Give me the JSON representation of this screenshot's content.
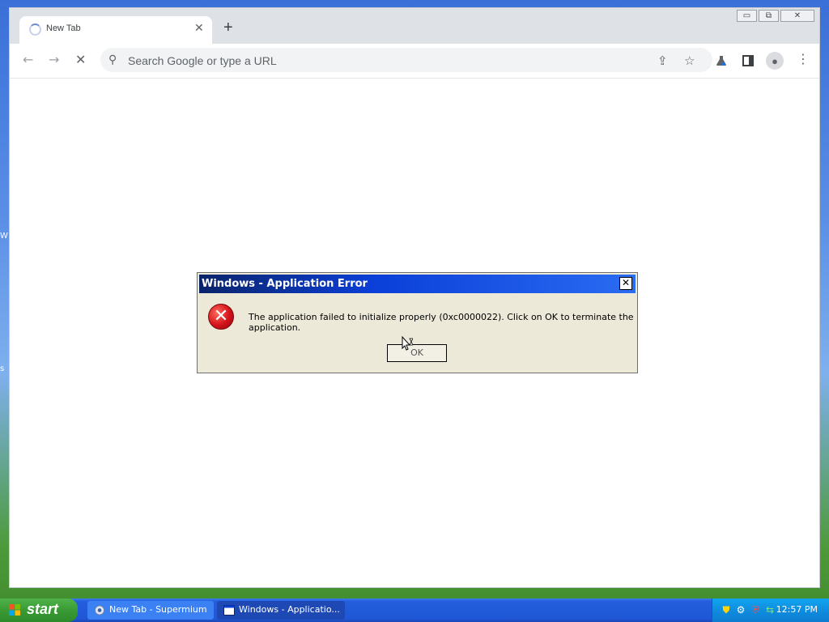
{
  "desktop": {
    "edge_letters": [
      "W",
      "s"
    ]
  },
  "browser": {
    "tab": {
      "title": "New Tab",
      "close_glyph": "✕"
    },
    "new_tab_glyph": "+",
    "window_controls": {
      "minimize": "▭",
      "restore": "⧉",
      "close": "✕"
    },
    "nav": {
      "back_glyph": "←",
      "forward_glyph": "→",
      "stop_glyph": "✕"
    },
    "omnibox": {
      "placeholder": "Search Google or type a URL",
      "value": ""
    },
    "icons": [
      "share-icon",
      "star-icon",
      "labs-icon",
      "side-panel-icon",
      "profile-icon",
      "menu-icon"
    ]
  },
  "dialog": {
    "title": "Windows - Application Error",
    "close_glyph": "✕",
    "message": "The application failed to initialize properly (0xc0000022). Click on OK to terminate the application.",
    "ok_label": "OK"
  },
  "taskbar": {
    "start_label": "start",
    "items": [
      {
        "label": "New Tab - Supermium",
        "active": false
      },
      {
        "label": "Windows - Applicatio...",
        "active": true
      }
    ],
    "clock": "12:57 PM"
  }
}
